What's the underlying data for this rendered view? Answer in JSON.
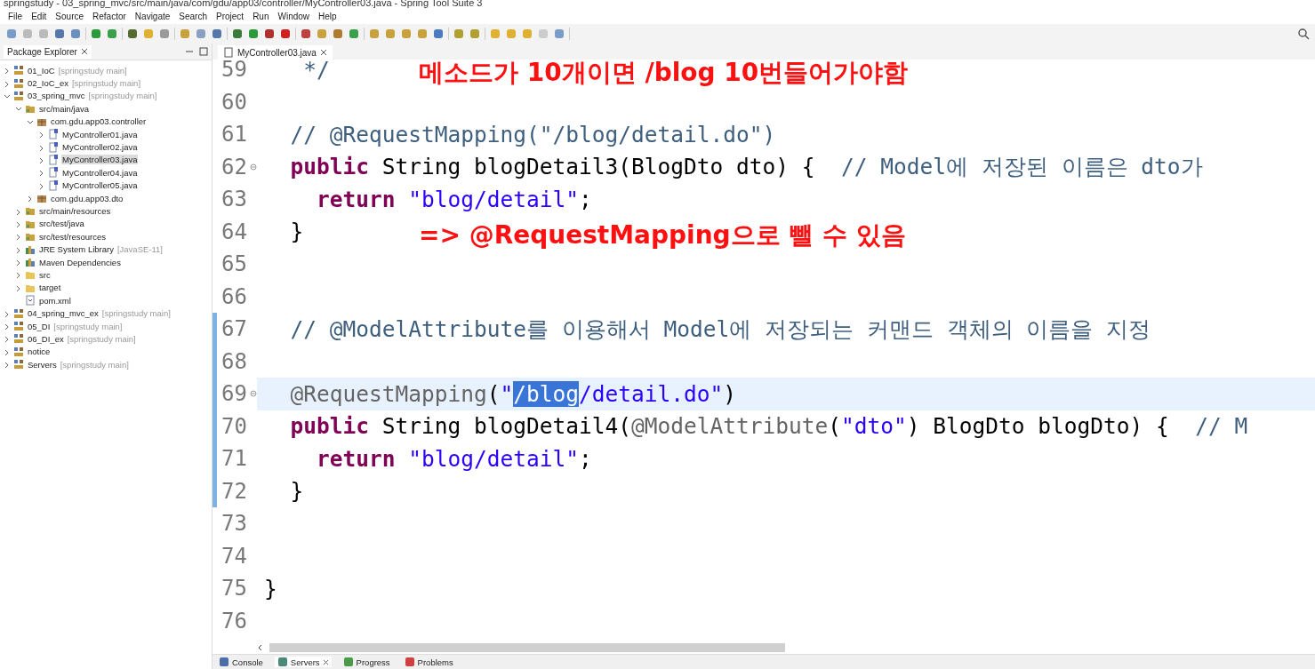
{
  "window": {
    "title": "springstudy - 03_spring_mvc/src/main/java/com/gdu/app03/controller/MyController03.java - Spring Tool Suite 3"
  },
  "menu": [
    "File",
    "Edit",
    "Source",
    "Refactor",
    "Navigate",
    "Search",
    "Project",
    "Run",
    "Window",
    "Help"
  ],
  "package_explorer": {
    "title": "Package Explorer",
    "items": [
      {
        "name": "01_IoC",
        "decoration": "[springstudy main]",
        "kind": "project",
        "expanded": false,
        "selected": false
      },
      {
        "name": "02_IoC_ex",
        "decoration": "[springstudy main]",
        "kind": "project",
        "expanded": false,
        "selected": false
      },
      {
        "name": "03_spring_mvc",
        "decoration": "[springstudy main]",
        "kind": "project",
        "expanded": true,
        "selected": false,
        "children": [
          {
            "name": "src/main/java",
            "kind": "source",
            "expanded": true,
            "selected": false,
            "children": [
              {
                "name": "com.gdu.app03.controller",
                "kind": "package",
                "expanded": true,
                "selected": false,
                "children": [
                  {
                    "name": "MyController01.java",
                    "kind": "java",
                    "expanded": false,
                    "selected": false
                  },
                  {
                    "name": "MyController02.java",
                    "kind": "java",
                    "expanded": false,
                    "selected": false
                  },
                  {
                    "name": "MyController03.java",
                    "kind": "java",
                    "expanded": false,
                    "selected": true
                  },
                  {
                    "name": "MyController04.java",
                    "kind": "java",
                    "expanded": false,
                    "selected": false
                  },
                  {
                    "name": "MyController05.java",
                    "kind": "java",
                    "expanded": false,
                    "selected": false
                  }
                ]
              },
              {
                "name": "com.gdu.app03.dto",
                "kind": "package",
                "expanded": false,
                "selected": false
              }
            ]
          },
          {
            "name": "src/main/resources",
            "kind": "source",
            "expanded": false,
            "selected": false
          },
          {
            "name": "src/test/java",
            "kind": "source",
            "expanded": false,
            "selected": false
          },
          {
            "name": "src/test/resources",
            "kind": "source",
            "expanded": false,
            "selected": false
          },
          {
            "name": "JRE System Library",
            "decoration": "[JavaSE-11]",
            "kind": "library",
            "expanded": false,
            "selected": false
          },
          {
            "name": "Maven Dependencies",
            "kind": "library",
            "expanded": false,
            "selected": false
          },
          {
            "name": "src",
            "kind": "folder",
            "expanded": false,
            "selected": false
          },
          {
            "name": "target",
            "kind": "folder",
            "expanded": false,
            "selected": false
          },
          {
            "name": "pom.xml",
            "kind": "file",
            "selected": false
          }
        ]
      },
      {
        "name": "04_spring_mvc_ex",
        "decoration": "[springstudy main]",
        "kind": "project",
        "expanded": false,
        "selected": false
      },
      {
        "name": "05_DI",
        "decoration": "[springstudy main]",
        "kind": "project",
        "expanded": false,
        "selected": false
      },
      {
        "name": "06_DI_ex",
        "decoration": "[springstudy main]",
        "kind": "project",
        "expanded": false,
        "selected": false
      },
      {
        "name": "notice",
        "kind": "project",
        "expanded": false,
        "selected": false
      },
      {
        "name": "Servers",
        "decoration": "[springstudy main]",
        "kind": "project",
        "expanded": false,
        "selected": false
      }
    ]
  },
  "editor": {
    "tab": "MyController03.java",
    "lines": [
      {
        "number": "59",
        "tokens": [
          {
            "text": "   */",
            "kind": "comment"
          }
        ],
        "note": "메소드가 10개이면 /blog 10번들어가야함"
      },
      {
        "number": "60"
      },
      {
        "number": "61",
        "tokens": [
          {
            "text": "  // @RequestMapping(\"/blog/detail.do\")",
            "kind": "comment"
          }
        ]
      },
      {
        "number": "62",
        "fold": true,
        "tokens": [
          {
            "text": "  public",
            "kind": "keyword"
          },
          {
            "text": " String blogDetail3(BlogDto dto) {  ",
            "kind": "plain"
          },
          {
            "text": "// Model에 저장된 이름은 dto가",
            "kind": "comment"
          }
        ]
      },
      {
        "number": "63",
        "tokens": [
          {
            "text": "    return",
            "kind": "keyword"
          },
          {
            "text": " \"blog/detail\"",
            "kind": "string"
          },
          {
            "text": ";",
            "kind": "plain"
          }
        ]
      },
      {
        "number": "64",
        "tokens": [
          {
            "text": "  }",
            "kind": "plain"
          }
        ],
        "note": "=> @RequestMapping으로 뺄 수 있음"
      },
      {
        "number": "65"
      },
      {
        "number": "66"
      },
      {
        "number": "67",
        "changed": true,
        "tokens": [
          {
            "text": "  // @ModelAttribute를 이용해서 Model에 저장되는 커맨드 객체의 이름을 지정",
            "kind": "comment"
          }
        ]
      },
      {
        "number": "68",
        "changed": true
      },
      {
        "number": "69",
        "changed": true,
        "current": true,
        "fold": true,
        "tokens": [
          {
            "text": "  @RequestMapping",
            "kind": "annotation"
          },
          {
            "text": "(",
            "kind": "plain"
          },
          {
            "text": "\"",
            "kind": "string"
          },
          {
            "text": "/blog",
            "kind": "selected"
          },
          {
            "text": "/detail.do\"",
            "kind": "string"
          },
          {
            "text": ")",
            "kind": "plain"
          }
        ]
      },
      {
        "number": "70",
        "changed": true,
        "tokens": [
          {
            "text": "  public",
            "kind": "keyword"
          },
          {
            "text": " String blogDetail4(",
            "kind": "plain"
          },
          {
            "text": "@ModelAttribute",
            "kind": "annotation"
          },
          {
            "text": "(",
            "kind": "plain"
          },
          {
            "text": "\"dto\"",
            "kind": "string"
          },
          {
            "text": ") BlogDto blogDto) {  ",
            "kind": "plain"
          },
          {
            "text": "// M",
            "kind": "comment"
          }
        ]
      },
      {
        "number": "71",
        "changed": true,
        "tokens": [
          {
            "text": "    return",
            "kind": "keyword"
          },
          {
            "text": " \"blog/detail\"",
            "kind": "string"
          },
          {
            "text": ";",
            "kind": "plain"
          }
        ]
      },
      {
        "number": "72",
        "changed": true,
        "tokens": [
          {
            "text": "  }",
            "kind": "plain"
          }
        ]
      },
      {
        "number": "73"
      },
      {
        "number": "74"
      },
      {
        "number": "75",
        "tokens": [
          {
            "text": "}",
            "kind": "plain"
          }
        ]
      },
      {
        "number": "76"
      }
    ]
  },
  "bottom_tabs": [
    {
      "label": "Console",
      "kind": "console",
      "selected": false
    },
    {
      "label": "Servers",
      "kind": "servers",
      "selected": true,
      "closable": true
    },
    {
      "label": "Progress",
      "kind": "progress",
      "selected": false
    },
    {
      "label": "Problems",
      "kind": "problems",
      "selected": false
    }
  ]
}
